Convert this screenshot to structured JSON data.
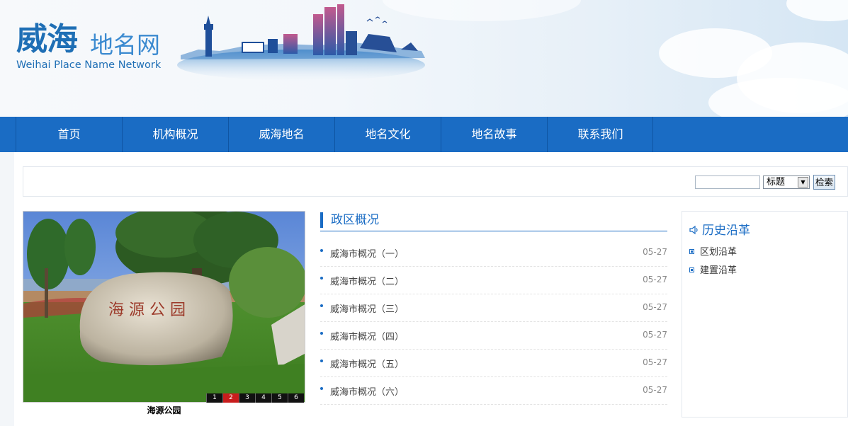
{
  "header": {
    "logo_main": "威海",
    "logo_sub": "地名网",
    "logo_en": "Weihai Place Name Network"
  },
  "nav": {
    "items": [
      {
        "label": "首页"
      },
      {
        "label": "机构概况"
      },
      {
        "label": "威海地名"
      },
      {
        "label": "地名文化"
      },
      {
        "label": "地名故事"
      },
      {
        "label": "联系我们"
      }
    ]
  },
  "search": {
    "input_value": "",
    "select_value": "标题",
    "button_label": "检索"
  },
  "slideshow": {
    "caption": "海源公园",
    "pages": [
      "1",
      "2",
      "3",
      "4",
      "5",
      "6"
    ],
    "active_page": "2"
  },
  "main_section": {
    "title": "政区概况",
    "items": [
      {
        "title": "威海市概况（一）",
        "date": "05-27"
      },
      {
        "title": "威海市概况（二）",
        "date": "05-27"
      },
      {
        "title": "威海市概况（三）",
        "date": "05-27"
      },
      {
        "title": "威海市概况（四）",
        "date": "05-27"
      },
      {
        "title": "威海市概况（五）",
        "date": "05-27"
      },
      {
        "title": "威海市概况（六）",
        "date": "05-27"
      }
    ]
  },
  "sidebar": {
    "title": "历史沿革",
    "title_icon": "speaker-icon",
    "items": [
      {
        "label": "区划沿革"
      },
      {
        "label": "建置沿革"
      }
    ]
  },
  "colors": {
    "brand_blue": "#1a6cc4",
    "pager_active": "#c81d1d"
  }
}
